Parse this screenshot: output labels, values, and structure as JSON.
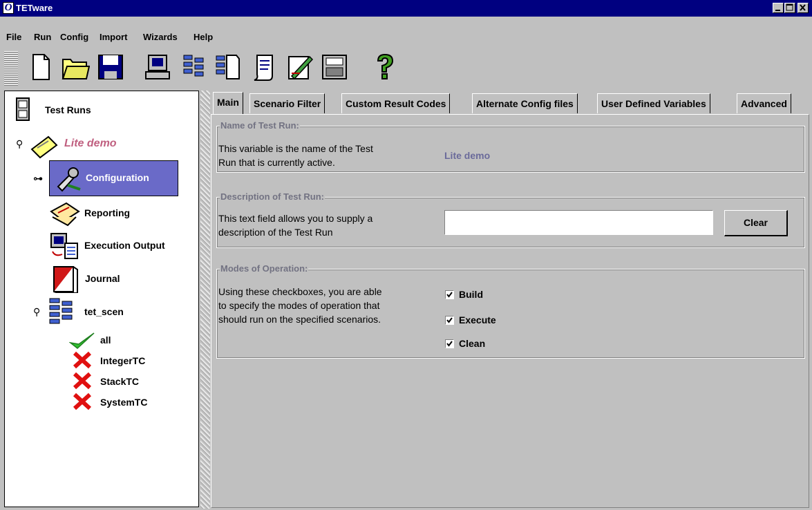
{
  "window": {
    "logo_glyph": "O",
    "title": "TETware"
  },
  "menu": [
    "File",
    "Run",
    "Config",
    "Import",
    "Wizards",
    "Help"
  ],
  "toolbar": {
    "buttons": [
      "new-document-icon",
      "open-folder-icon",
      "save-disk-icon",
      "computer-icon",
      "scenario-icon",
      "document-list-icon",
      "report-scroll-icon",
      "edit-notepad-icon",
      "journal-archive-icon",
      "help-question-icon"
    ]
  },
  "tree": {
    "root_label": "Test Runs",
    "run_label": "Lite demo",
    "items": {
      "configuration": "Configuration",
      "reporting": "Reporting",
      "execution_output": "Execution Output",
      "journal": "Journal",
      "tet_scen": "tet_scen"
    },
    "scenarios": [
      {
        "label": "all",
        "status": "pass"
      },
      {
        "label": "IntegerTC",
        "status": "fail"
      },
      {
        "label": "StackTC",
        "status": "fail"
      },
      {
        "label": "SystemTC",
        "status": "fail"
      }
    ]
  },
  "tabs": [
    "Main",
    "Scenario Filter",
    "Custom Result Codes",
    "Alternate Config files",
    "User Defined Variables",
    "Advanced"
  ],
  "main": {
    "name_group": {
      "title": "Name of Test Run:",
      "desc_line1": "This variable is the name of the Test",
      "desc_line2": "Run that is currently active.",
      "value": "Lite demo"
    },
    "description_group": {
      "title": "Description of Test Run:",
      "desc_line1": "This text field allows you to supply a",
      "desc_line2": "description of the Test Run",
      "input_value": "",
      "clear_label": "Clear"
    },
    "modes_group": {
      "title": "Modes of Operation:",
      "desc_line1": "Using these checkboxes, you are able",
      "desc_line2": "to specify the modes of operation that",
      "desc_line3": "should run on the specified scenarios.",
      "checkboxes": [
        {
          "label": "Build",
          "checked": true
        },
        {
          "label": "Execute",
          "checked": true
        },
        {
          "label": "Clean",
          "checked": true
        }
      ]
    }
  },
  "colors": {
    "titlebar": "#000080",
    "selection": "#6a6ac8",
    "run_label": "#c06080",
    "group_title": "#727282",
    "value_text": "#6a6a9a"
  }
}
